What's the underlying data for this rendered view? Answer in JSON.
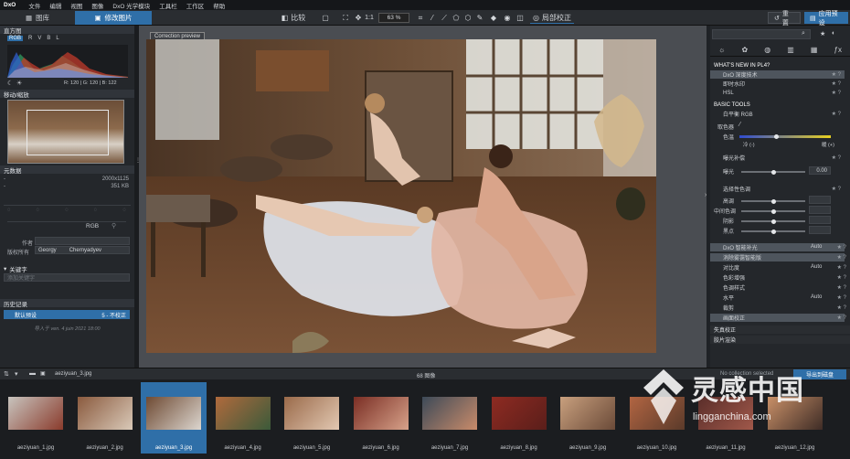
{
  "menubar": {
    "logo": "DxO",
    "items": [
      "文件",
      "编辑",
      "视图",
      "图像",
      "DxO 光学模块",
      "工具栏",
      "工作区",
      "帮助"
    ]
  },
  "toolbar": {
    "tab_library": "图库",
    "tab_customize": "修改图片",
    "compare": "比较",
    "zoom_1to1": "1:1",
    "zoom_value": "63 %",
    "local_adjust": "局部校正",
    "reset": "重置",
    "apply_preset": "应用预设"
  },
  "left": {
    "histogram_title": "直方图",
    "channels": [
      "RGB",
      "R",
      "V",
      "B",
      "L"
    ],
    "rgb_readout": "R: 120 | G: 120 | B: 122",
    "move_zoom_title": "移动/缩放",
    "metadata_title": "元数据",
    "dimensions": "2000x1125",
    "filesize": "351 KB",
    "dash1": "-",
    "dash2": "-",
    "rgb_label": "RGB",
    "author_label": "作者",
    "copyright_label": "版权所有",
    "copyright_first": "Georgy",
    "copyright_last": "Chernyadyev",
    "keywords_title": "关键字",
    "keywords_placeholder": "添加关键字",
    "history_title": "历史记录",
    "history_item": "默认预设",
    "history_status": "5 - 不校正",
    "history_import": "导入于 ven. 4 juin 2021 18:00"
  },
  "viewer": {
    "overlay_label": "Correction preview"
  },
  "right": {
    "search_placeholder": "",
    "whats_new": "WHAT'S NEW IN PL4?",
    "whats_new_items": [
      "DxO 深度技术",
      "即时水印",
      "HSL"
    ],
    "basic_tools": "BASIC TOOLS",
    "white_balance": "白平衡 RGB",
    "picker_label": "取色器",
    "tint_label": "色温",
    "cold_label": "冷 (-)",
    "warm_label": "暖 (+)",
    "exposure_title": "曝光补偿",
    "exposure_label": "曝光",
    "exposure_value": "0.00",
    "tone_title": "选择性色调",
    "tone_items": [
      "高调",
      "中间色调",
      "阴影",
      "黑点"
    ],
    "smart_lighting": "DxO 智能补光",
    "smart_value": "Auto",
    "haze": "消除雾霭智能版",
    "contrast": "对比度",
    "contrast_value": "Auto",
    "color_accent": "色彩增强",
    "color_mode": "色调样式",
    "level": "水平",
    "level_value": "Auto",
    "crop": "裁剪",
    "geometry": "画面校正",
    "lens": "失真校正",
    "color_render": "胶片渲染"
  },
  "filmbar": {
    "filename": "aeziyuan_3.jpg",
    "count": "68 图像",
    "collection": "No collection selected",
    "export": "导出到磁盘"
  },
  "film": {
    "thumbs": [
      {
        "name": "aeziyuan_1.jpg",
        "c1": "#c8c4be",
        "c2": "#8a3b2c"
      },
      {
        "name": "aeziyuan_2.jpg",
        "c1": "#8a5a3e",
        "c2": "#d9c9b8"
      },
      {
        "name": "aeziyuan_3.jpg",
        "c1": "#6e4a33",
        "c2": "#dcd6cf"
      },
      {
        "name": "aeziyuan_4.jpg",
        "c1": "#b06a3d",
        "c2": "#3b5a3a"
      },
      {
        "name": "aeziyuan_5.jpg",
        "c1": "#9a6a4a",
        "c2": "#e2c8b2"
      },
      {
        "name": "aeziyuan_6.jpg",
        "c1": "#7a2e24",
        "c2": "#d7a28a"
      },
      {
        "name": "aeziyuan_7.jpg",
        "c1": "#3d4a58",
        "c2": "#c98b6a"
      },
      {
        "name": "aeziyuan_8.jpg",
        "c1": "#8e2b22",
        "c2": "#5a1e1a"
      },
      {
        "name": "aeziyuan_9.jpg",
        "c1": "#c9a07e",
        "c2": "#6a4a38"
      },
      {
        "name": "aeziyuan_10.jpg",
        "c1": "#b26542",
        "c2": "#5a3a2a"
      },
      {
        "name": "aeziyuan_11.jpg",
        "c1": "#5a2e2a",
        "c2": "#a0584a"
      },
      {
        "name": "aeziyuan_12.jpg",
        "c1": "#c99068",
        "c2": "#3e2c26"
      }
    ]
  },
  "watermark": {
    "brand": "灵感中国",
    "url": "lingganchina.com"
  }
}
